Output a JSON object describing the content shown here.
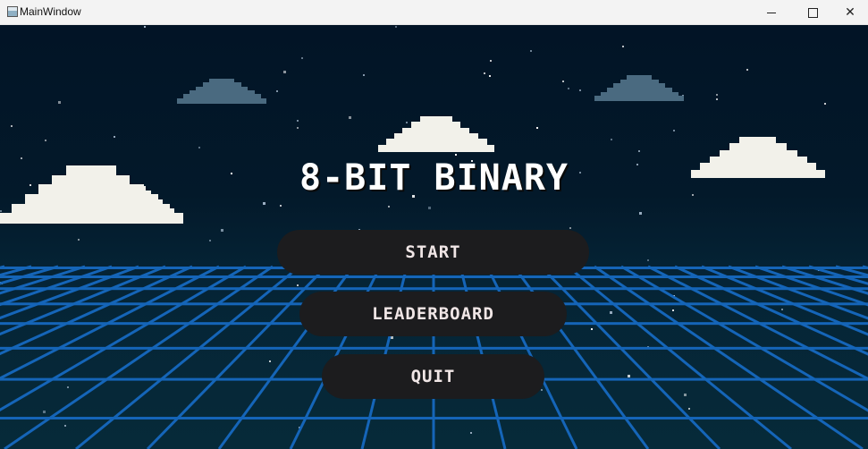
{
  "window": {
    "title": "MainWindow",
    "minimize_glyph": "",
    "close_glyph": "✕"
  },
  "game": {
    "title": "8-BIT BINARY"
  },
  "menu": {
    "start_label": "START",
    "leaderboard_label": "LEADERBOARD",
    "quit_label": "QUIT"
  },
  "colors": {
    "sky_top": "#021426",
    "sky_bottom": "#062a39",
    "grid_line": "#1565b8",
    "cloud_bright": "#f2f1ea",
    "cloud_dim": "#4a6a80",
    "button_bg": "#1c1c1e",
    "button_text": "#f0e6e6",
    "title_text": "#ffffff"
  },
  "icons": [
    "app-icon",
    "minimize-icon",
    "maximize-icon",
    "close-icon"
  ]
}
